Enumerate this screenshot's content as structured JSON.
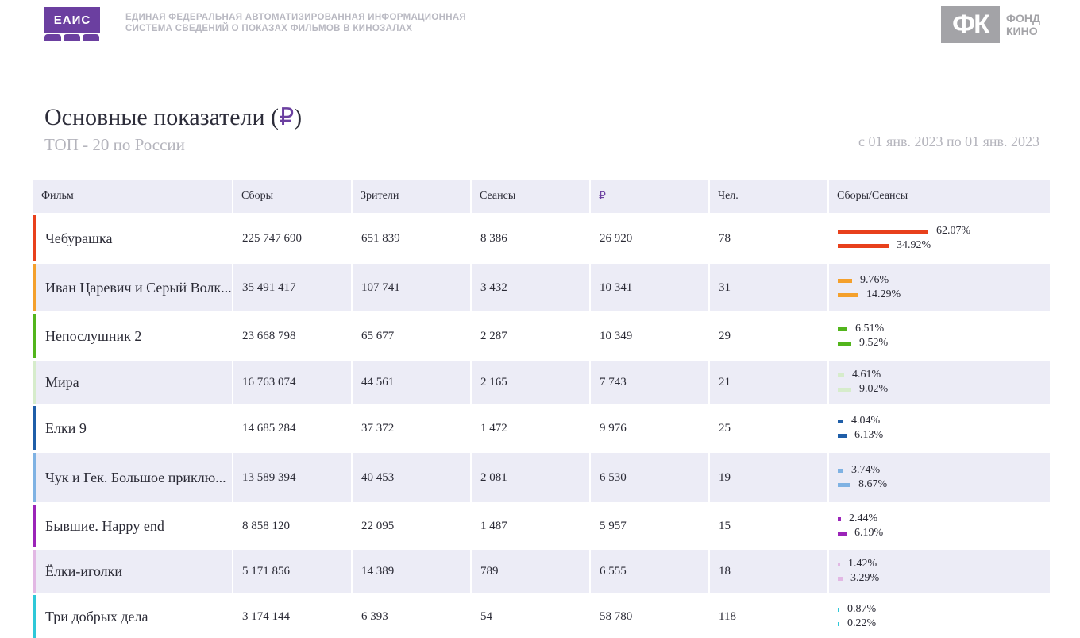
{
  "header": {
    "logo_text": "ЕАИС",
    "system_line1": "ЕДИНАЯ ФЕДЕРАЛЬНАЯ АВТОМАТИЗИРОВАННАЯ ИНФОРМАЦИОННАЯ",
    "system_line2": "СИСТЕМА СВЕДЕНИЙ О ПОКАЗАХ ФИЛЬМОВ В КИНОЗАЛАХ",
    "fk_logo": "ФК",
    "fk_line1": "ФОНД",
    "fk_line2": "КИНО"
  },
  "title": {
    "main": "Основные показатели (",
    "currency": "₽",
    "close": ")",
    "subtitle": "ТОП - 20 по России",
    "period": "с 01 янв. 2023 по 01 янв. 2023"
  },
  "columns": {
    "film": "Фильм",
    "gross": "Сборы",
    "viewers": "Зрители",
    "sessions": "Сеансы",
    "avg_price": "₽",
    "per_session": "Чел.",
    "ratio": "Сборы/Сеансы"
  },
  "rows": [
    {
      "film": "Чебурашка",
      "gross": "225 747 690",
      "viewers": "651 839",
      "sessions": "8 386",
      "avg_price": "26 920",
      "per_session": "78",
      "gross_share": "62.07%",
      "sessions_share": "34.92%",
      "gross_share_value": 62.07,
      "sessions_share_value": 34.92,
      "color": "#e8401c"
    },
    {
      "film": "Иван Царевич и Серый Волк...",
      "gross": "35 491 417",
      "viewers": "107 741",
      "sessions": "3 432",
      "avg_price": "10 341",
      "per_session": "31",
      "gross_share": "9.76%",
      "sessions_share": "14.29%",
      "gross_share_value": 9.76,
      "sessions_share_value": 14.29,
      "color": "#f4a02c"
    },
    {
      "film": "Непослушник 2",
      "gross": "23 668 798",
      "viewers": "65 677",
      "sessions": "2 287",
      "avg_price": "10 349",
      "per_session": "29",
      "gross_share": "6.51%",
      "sessions_share": "9.52%",
      "gross_share_value": 6.51,
      "sessions_share_value": 9.52,
      "color": "#52b51c"
    },
    {
      "film": "Мира",
      "gross": "16 763 074",
      "viewers": "44 561",
      "sessions": "2 165",
      "avg_price": "7 743",
      "per_session": "21",
      "gross_share": "4.61%",
      "sessions_share": "9.02%",
      "gross_share_value": 4.61,
      "sessions_share_value": 9.02,
      "color": "#d6eccb"
    },
    {
      "film": "Елки 9",
      "gross": "14 685 284",
      "viewers": "37 372",
      "sessions": "1 472",
      "avg_price": "9 976",
      "per_session": "25",
      "gross_share": "4.04%",
      "sessions_share": "6.13%",
      "gross_share_value": 4.04,
      "sessions_share_value": 6.13,
      "color": "#1f5ea8"
    },
    {
      "film": "Чук и Гек. Большое приклю...",
      "gross": "13 589 394",
      "viewers": "40 453",
      "sessions": "2 081",
      "avg_price": "6 530",
      "per_session": "19",
      "gross_share": "3.74%",
      "sessions_share": "8.67%",
      "gross_share_value": 3.74,
      "sessions_share_value": 8.67,
      "color": "#7fb2e3"
    },
    {
      "film": "Бывшие. Happy end",
      "gross": "8 858 120",
      "viewers": "22 095",
      "sessions": "1 487",
      "avg_price": "5 957",
      "per_session": "15",
      "gross_share": "2.44%",
      "sessions_share": "6.19%",
      "gross_share_value": 2.44,
      "sessions_share_value": 6.19,
      "color": "#9b24b8"
    },
    {
      "film": "Ёлки-иголки",
      "gross": "5 171 856",
      "viewers": "14 389",
      "sessions": "789",
      "avg_price": "6 555",
      "per_session": "18",
      "gross_share": "1.42%",
      "sessions_share": "3.29%",
      "gross_share_value": 1.42,
      "sessions_share_value": 3.29,
      "color": "#e2b8e4"
    },
    {
      "film": "Три добрых дела",
      "gross": "3 174 144",
      "viewers": "6 393",
      "sessions": "54",
      "avg_price": "58 780",
      "per_session": "118",
      "gross_share": "0.87%",
      "sessions_share": "0.22%",
      "gross_share_value": 0.87,
      "sessions_share_value": 0.22,
      "color": "#2ec8d8"
    }
  ]
}
